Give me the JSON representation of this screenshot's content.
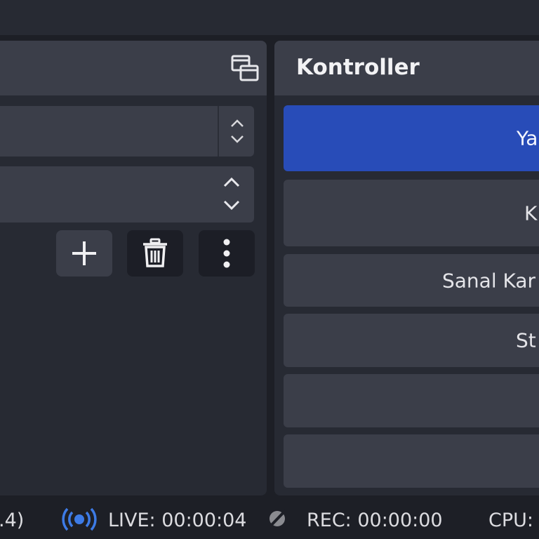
{
  "sources_panel": {
    "float_icon": "undock-icon",
    "buttons": {
      "add_icon": "plus-icon",
      "delete_icon": "trash-icon",
      "more_icon": "kebab-menu-icon"
    }
  },
  "controls": {
    "title": "Kontroller",
    "buttons": [
      {
        "label": "Ya",
        "primary": true
      },
      {
        "label": "K",
        "primary": false
      },
      {
        "label": "Sanal Kar",
        "primary": false
      },
      {
        "label": "St",
        "primary": false
      },
      {
        "label": "",
        "primary": false
      },
      {
        "label": "",
        "primary": false
      }
    ]
  },
  "status": {
    "version_fragment": ".4)",
    "live_icon": "broadcast-icon",
    "live": "LIVE: 00:00:04",
    "rec_icon": "recording-off-icon",
    "rec": "REC: 00:00:00",
    "cpu": "CPU:"
  },
  "colors": {
    "accent": "#284cb8",
    "live_icon": "#3d7be6",
    "panel": "#272a33",
    "header": "#3b3e49",
    "background": "#1d1f26"
  }
}
